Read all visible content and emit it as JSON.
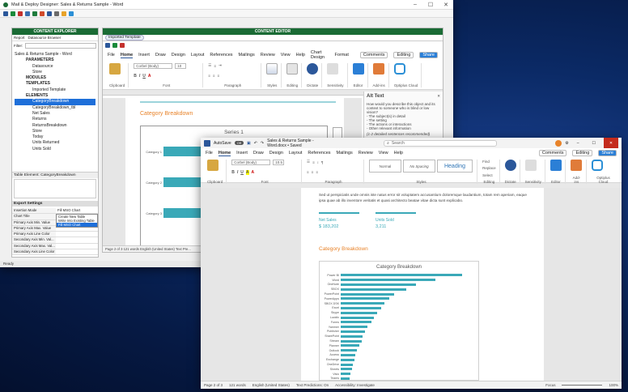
{
  "back": {
    "title": "Mail & Deploy Designer: Sales & Returns Sample - Word",
    "explorer_header": "CONTENT EXPLORER",
    "editor_header": "CONTENT EDITOR",
    "tab_report": "Report",
    "tab_datasource": "Datasource Browser",
    "filter_label": "Filter:",
    "editor_tab": "Imported Template",
    "tree": [
      {
        "label": "Sales & Returns Sample - Word",
        "level": 0
      },
      {
        "label": "PARAMETERS",
        "level": 1
      },
      {
        "label": "Datasource",
        "level": 2
      },
      {
        "label": "Store",
        "level": 2
      },
      {
        "label": "MODULES",
        "level": 1
      },
      {
        "label": "TEMPLATES",
        "level": 1
      },
      {
        "label": "Imported Template",
        "level": 2
      },
      {
        "label": "ELEMENTS",
        "level": 1
      },
      {
        "label": "CategoryBreakdown",
        "level": 2,
        "selected": true
      },
      {
        "label": "CategoryBreakdown_tbl",
        "level": 2
      },
      {
        "label": "Net Sales",
        "level": 2
      },
      {
        "label": "Returns",
        "level": 2
      },
      {
        "label": "ReturnsBreakdown",
        "level": 2
      },
      {
        "label": "Store",
        "level": 2
      },
      {
        "label": "Today",
        "level": 2
      },
      {
        "label": "Units Returned",
        "level": 2
      },
      {
        "label": "Units Sold",
        "level": 2
      }
    ],
    "table_element": "Table Element: CategoryBreakdown",
    "export_settings": "Export Settings",
    "props": [
      {
        "name": "Insertion Mode",
        "value": "Fill MSO Chart"
      },
      {
        "name": "Chart Title",
        "value": ""
      },
      {
        "name": "Primary Axis Min. Value",
        "value": ""
      },
      {
        "name": "Primary Axis Max. Value",
        "value": ""
      },
      {
        "name": "Primary Axis Line Color",
        "value": ""
      },
      {
        "name": "Secondary Axis Min. Val...",
        "value": ""
      },
      {
        "name": "Secondary Axis Max. Val...",
        "value": ""
      },
      {
        "name": "Secondary Axis Line Color",
        "value": ""
      }
    ],
    "dropdown_options": [
      "Create New Table",
      "Write Into Existing Table",
      "Fill MSO Chart"
    ],
    "ready": "Ready",
    "ribbon_tabs": [
      "File",
      "Home",
      "Insert",
      "Draw",
      "Design",
      "Layout",
      "References",
      "Mailings",
      "Review",
      "View",
      "Help",
      "Chart Design",
      "Format"
    ],
    "ribbon_right": [
      "Comments",
      "Editing",
      "Share"
    ],
    "font_name": "Corbel (Body)",
    "font_size": "10",
    "groups": [
      "Clipboard",
      "Font",
      "Paragraph",
      "Styles",
      "Voice",
      "Sensitivity",
      "Editor",
      "Add-ins",
      "Optiplus Cloud"
    ],
    "group_buttons": [
      "Paste",
      "Styles",
      "Editing",
      "Dictate",
      "Sensitivity",
      "Editor",
      "Add-ins"
    ],
    "doc_heading": "Category Breakdown",
    "chart_title": "Series 1",
    "categories_back": [
      "Category 1",
      "Category 2",
      "Category 3"
    ],
    "alt_text": {
      "title": "Alt Text",
      "body": "How would you describe this object and its context to someone who is blind or low vision?",
      "points": [
        "- The subject(s) in detail",
        "- The setting",
        "- The actions or interactions",
        "- Other relevant information"
      ],
      "detail": "(1-2 detailed sentences recommended)"
    },
    "status": "Page 2 of 3   121 words   English (United States)   Text Pre..."
  },
  "front": {
    "autosave": "AutoSave",
    "autosave_state": "Off",
    "title": "Sales & Returns Sample - Word.docx • Saved",
    "search": "Search",
    "ribbon_tabs": [
      "File",
      "Home",
      "Insert",
      "Draw",
      "Design",
      "Layout",
      "References",
      "Mailings",
      "Review",
      "View",
      "Help"
    ],
    "ribbon_right": [
      "Comments",
      "Editing",
      "Share"
    ],
    "font_name": "Corbel (Body)",
    "font_size": "10.5",
    "styles": [
      "Normal",
      "No Spacing",
      "Heading"
    ],
    "find": [
      "Find",
      "Replace",
      "Select"
    ],
    "group_labels": [
      "Clipboard",
      "Font",
      "Paragraph",
      "Styles",
      "Editing",
      "Voice",
      "Sensitivity",
      "Editor",
      "Add-ins",
      "Optiplus Cloud"
    ],
    "group_buttons": [
      "Paste",
      "Dictate",
      "Sensitivity",
      "Editor",
      "Add-ins"
    ],
    "body_text": "Sed ut perspiciatis unde omnis iste natus error sit voluptatem accusantium doloremque laudantium, totam rem aperiam, eaque ipsa quae ab illo inventore veritatis et quasi architecto beatae vitae dicta sunt explicabo.",
    "kpi": [
      {
        "label": "Net Sales",
        "value": "$ 183,202"
      },
      {
        "label": "Units Sold",
        "value": "3,211"
      }
    ],
    "section_heading": "Category Breakdown",
    "status": [
      "Page 2 of 3",
      "121 words",
      "English (United States)",
      "Text Predictions: On",
      "Accessibility: Investigate"
    ],
    "status_right": [
      "Focus",
      "100%"
    ]
  },
  "chart_data": {
    "type": "bar",
    "title": "Category Breakdown",
    "categories": [
      "Power BI",
      "Word",
      "OneNote",
      "SBOX",
      "PowerPoint",
      "PowerApps",
      "SBOX DSK",
      "Excel",
      "Skype",
      "Lucidix",
      "Forms",
      "Yammer",
      "Publisher",
      "SharePoint",
      "Stream",
      "Planner",
      "Outlook",
      "Access",
      "Exchange",
      "OneDrive",
      "Sheets",
      "Visio",
      "Teams"
    ],
    "values": [
      100,
      78,
      62,
      54,
      44,
      40,
      36,
      33,
      30,
      27,
      25,
      22,
      20,
      18,
      17,
      15,
      13,
      12,
      11,
      10,
      9,
      8,
      7
    ],
    "xlim": [
      0,
      100
    ]
  },
  "colors": {
    "accent": "#3aa9b8",
    "heading": "#e8832a",
    "brand_green": "#1a6b35",
    "word_blue": "#2b579a",
    "title_bar_red": "#c42b1c"
  }
}
